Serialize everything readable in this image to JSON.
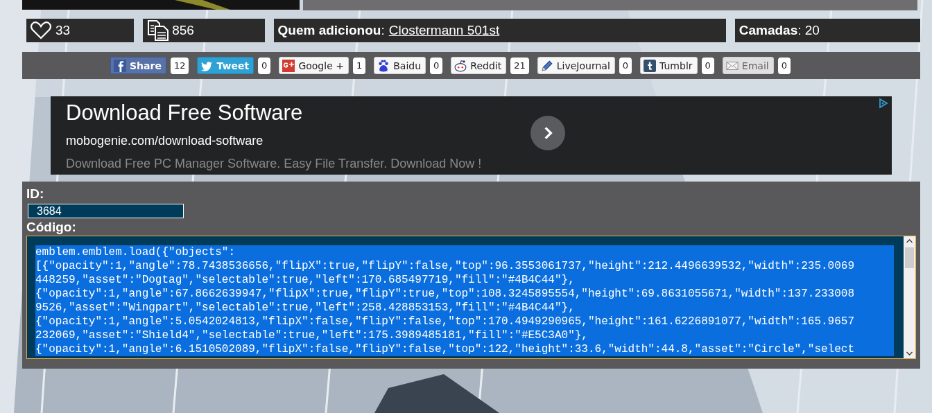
{
  "stats": {
    "likes": "33",
    "copies": "856",
    "added_by_label": "**Quem adicionou**:",
    "added_by": "Clostermann 501st",
    "layers": "**Camadas**: 20"
  },
  "share": [
    {
      "kind": "facebook",
      "label": "Share",
      "count": "12"
    },
    {
      "kind": "twitter",
      "label": "Tweet",
      "count": "0"
    },
    {
      "kind": "googleplus",
      "label": "Google +",
      "count": "1"
    },
    {
      "kind": "baidu",
      "label": "Baidu",
      "count": "0"
    },
    {
      "kind": "reddit",
      "label": "Reddit",
      "count": "21"
    },
    {
      "kind": "livejournal",
      "label": "LiveJournal",
      "count": "0"
    },
    {
      "kind": "tumblr",
      "label": "Tumblr",
      "count": "0"
    },
    {
      "kind": "email",
      "label": "Email",
      "count": "0"
    }
  ],
  "ad": {
    "title": "Download Free Software",
    "url": "mobogenie.com/download-software",
    "description": "Download Free PC Manager Software. Easy File Transfer. Download Now !"
  },
  "id_label": "ID:",
  "id_value": "3684",
  "code_label": "Código:",
  "code_lines": [
    "emblem.emblem.load({\"objects\":",
    "[{\"opacity\":1,\"angle\":78.7438536656,\"flipX\":true,\"flipY\":false,\"top\":96.3553061737,\"height\":212.4496639532,\"width\":235.0069",
    "448259,\"asset\":\"Dogtag\",\"selectable\":true,\"left\":170.685497719,\"fill\":\"#4B4C44\"},",
    "{\"opacity\":1,\"angle\":67.8662639947,\"flipX\":true,\"flipY\":true,\"top\":108.3245895554,\"height\":69.8631055671,\"width\":137.233008",
    "9526,\"asset\":\"Wingpart\",\"selectable\":true,\"left\":258.428853153,\"fill\":\"#4B4C44\"},",
    "{\"opacity\":1,\"angle\":5.0542024813,\"flipX\":false,\"flipY\":false,\"top\":170.4949290965,\"height\":161.6226891077,\"width\":165.9657",
    "232069,\"asset\":\"Shield4\",\"selectable\":true,\"left\":175.3989485181,\"fill\":\"#E5C3A0\"},",
    "{\"opacity\":1,\"angle\":6.1510502089,\"flipX\":false,\"flipY\":false,\"top\":122,\"height\":33.6,\"width\":44.8,\"asset\":\"Circle\",\"select"
  ]
}
